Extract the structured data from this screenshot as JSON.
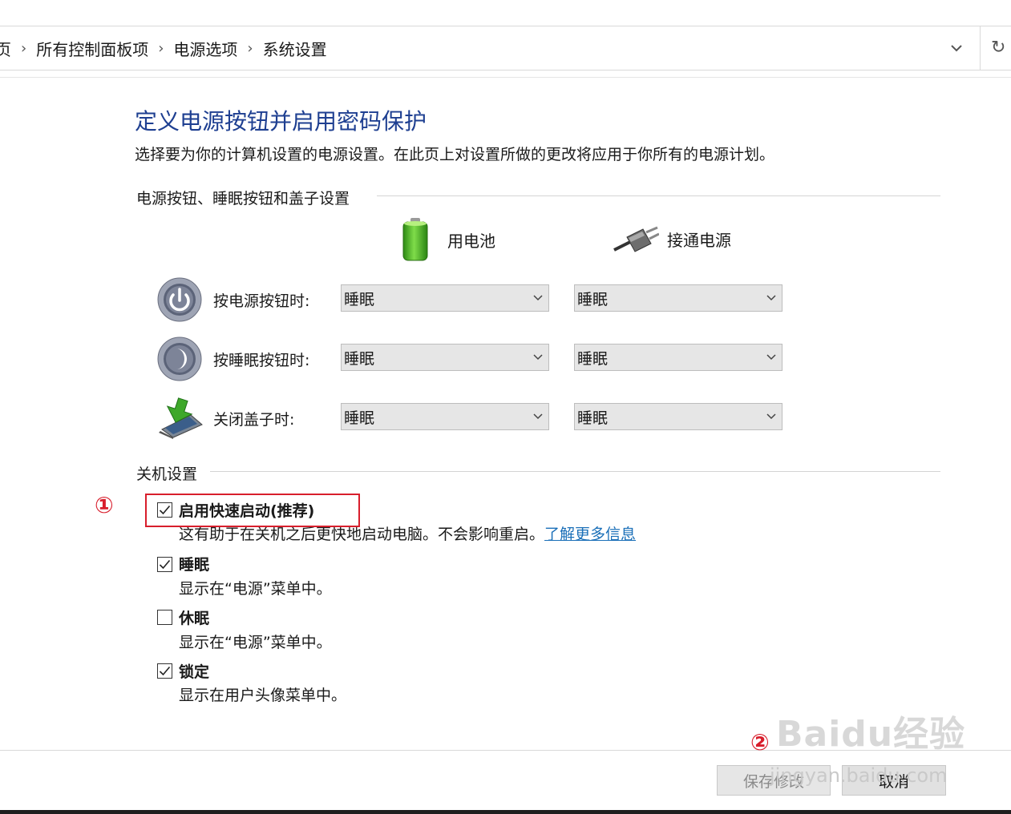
{
  "breadcrumb": {
    "items": [
      "页",
      "所有控制面板项",
      "电源选项",
      "系统设置"
    ]
  },
  "page": {
    "title": "定义电源按钮并启用密码保护",
    "description": "选择要为你的计算机设置的电源设置。在此页上对设置所做的更改将应用于你所有的电源计划。"
  },
  "power_section": {
    "label": "电源按钮、睡眠按钮和盖子设置",
    "battery_label": "用电池",
    "plugged_label": "接通电源",
    "rows": [
      {
        "label": "按电源按钮时:",
        "battery": "睡眠",
        "plugged": "睡眠"
      },
      {
        "label": "按睡眠按钮时:",
        "battery": "睡眠",
        "plugged": "睡眠"
      },
      {
        "label": "关闭盖子时:",
        "battery": "睡眠",
        "plugged": "睡眠"
      }
    ]
  },
  "shutdown_section": {
    "label": "关机设置",
    "options": [
      {
        "title": "启用快速启动(推荐)",
        "desc": "这有助于在关机之后更快地启动电脑。不会影响重启。",
        "link": "了解更多信息",
        "checked": true
      },
      {
        "title": "睡眠",
        "desc": "显示在“电源”菜单中。",
        "checked": true
      },
      {
        "title": "休眠",
        "desc": "显示在“电源”菜单中。",
        "checked": false
      },
      {
        "title": "锁定",
        "desc": "显示在用户头像菜单中。",
        "checked": true
      }
    ]
  },
  "annotations": {
    "marker1": "①",
    "marker2": "②"
  },
  "footer": {
    "save_label": "保存修改",
    "cancel_label": "取消"
  },
  "watermark": {
    "text": "Baidu经验",
    "url": "jingyan.baidu.com"
  },
  "colors": {
    "title": "#1e3f91",
    "link": "#1a6fb8",
    "annotation": "#d81e2c",
    "battery": "#3fb21f"
  }
}
